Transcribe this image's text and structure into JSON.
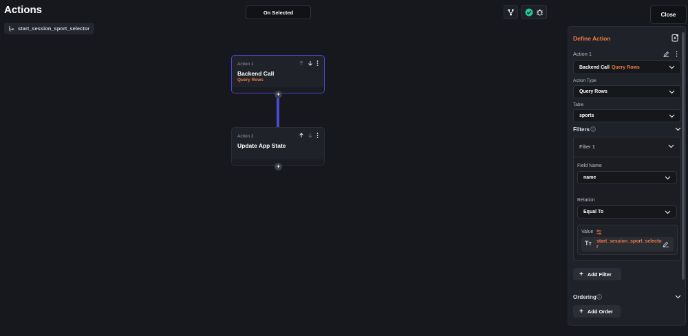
{
  "header": {
    "title": "Actions",
    "widget_name": "start_session_sport_selector",
    "trigger": "On Selected",
    "close_label": "Close"
  },
  "flow": {
    "nodes": [
      {
        "label": "Action 1",
        "title": "Backend Call",
        "subtitle": "Query Rows"
      },
      {
        "label": "Action 2",
        "title": "Update App State",
        "subtitle": ""
      }
    ],
    "add_symbol": "+"
  },
  "panel": {
    "title": "Define Action",
    "action_label": "Action 1",
    "action_select": {
      "main": "Backend Call",
      "accent": "Query Rows"
    },
    "action_type_label": "Action Type",
    "action_type_value": "Query Rows",
    "table_label": "Table",
    "table_value": "sports",
    "filters_label": "Filters",
    "filter": {
      "title": "Filter 1",
      "field_name_label": "Field Name",
      "field_name_value": "name",
      "relation_label": "Relation",
      "relation_value": "Equal To",
      "value_label": "Value",
      "value_text_line1": "start_session_sport_selecto",
      "value_text_line2": "r",
      "value_type_glyph": "Tт"
    },
    "add_filter_label": "Add Filter",
    "ordering_label": "Ordering",
    "add_order_label": "Add Order"
  },
  "colors": {
    "accent_orange": "#ef7d45",
    "accent_purple": "#4b48d6",
    "success_green": "#20c997"
  }
}
